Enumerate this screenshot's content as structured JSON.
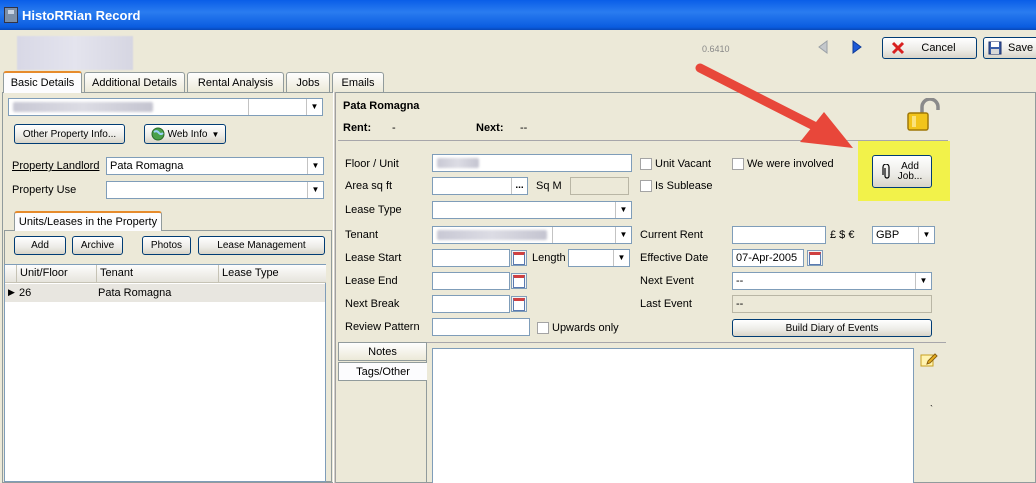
{
  "window": {
    "title": "HistoRRian Record"
  },
  "header": {
    "version": "0.6410",
    "cancel_label": "Cancel",
    "save_label": "Save"
  },
  "tabs": [
    {
      "label": "Basic Details"
    },
    {
      "label": "Additional Details"
    },
    {
      "label": "Rental Analysis"
    },
    {
      "label": "Jobs"
    },
    {
      "label": "Emails"
    }
  ],
  "left": {
    "other_property_info_label": "Other Property Info...",
    "web_info_label": "Web Info",
    "landlord_label": "Property Landlord",
    "landlord_value": "Pata Romagna",
    "use_label": "Property Use",
    "use_value": "",
    "units_tab_label": "Units/Leases in the Property",
    "add_label": "Add",
    "archive_label": "Archive",
    "photos_label": "Photos",
    "lease_mgmt_label": "Lease Management",
    "columns": [
      "Unit/Floor",
      "Tenant",
      "Lease Type"
    ],
    "rows": [
      {
        "unit": "26",
        "tenant": "Pata Romagna",
        "lease_type": ""
      }
    ]
  },
  "unit": {
    "title": "Pata Romagna",
    "rent_label": "Rent:",
    "rent_value": "-",
    "next_label": "Next:",
    "next_value": "--",
    "add_job_label_line1": "Add",
    "add_job_label_line2": "Job...",
    "floor_label": "Floor / Unit",
    "unit_vacant_label": "Unit Vacant",
    "we_involved_label": "We were involved",
    "area_label": "Area sq ft",
    "sqm_label": "Sq M",
    "is_sublease_label": "Is Sublease",
    "lease_type_label": "Lease Type",
    "tenant_label": "Tenant",
    "current_rent_label": "Current Rent",
    "currency_symbols": "£ $ €",
    "currency_value": "GBP",
    "lease_start_label": "Lease Start",
    "length_label": "Length",
    "effective_date_label": "Effective Date",
    "effective_date_value": "07-Apr-2005",
    "lease_end_label": "Lease End",
    "next_event_label": "Next Event",
    "next_event_value": "--",
    "next_break_label": "Next Break",
    "last_event_label": "Last Event",
    "last_event_value": "--",
    "review_pattern_label": "Review Pattern",
    "upwards_only_label": "Upwards only",
    "build_diary_label": "Build Diary of Events",
    "notes_tab_label": "Notes",
    "tags_tab_label": "Tags/Other",
    "ellipsis": "..."
  },
  "colors": {
    "highlight": "#f2f24a",
    "arrow": "#e8473a",
    "title_bar": "#0a5ee8"
  }
}
